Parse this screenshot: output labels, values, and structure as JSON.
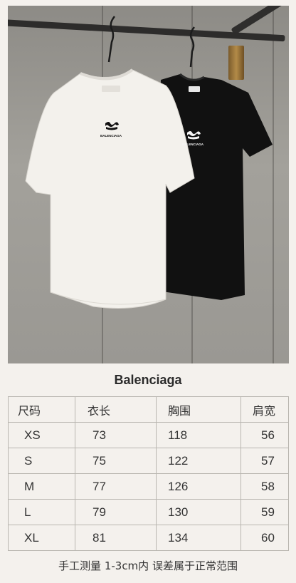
{
  "product": {
    "white_shirt_logo_text": "BALENCIAGA",
    "black_shirt_logo_text": "BALENCIAGA"
  },
  "title": "Balenciaga",
  "size_table": {
    "headers": [
      "尺码",
      "衣长",
      "胸围",
      "肩宽"
    ],
    "rows": [
      [
        "XS",
        "73",
        "118",
        "56"
      ],
      [
        "S",
        "75",
        "122",
        "57"
      ],
      [
        "M",
        "77",
        "126",
        "58"
      ],
      [
        "L",
        "79",
        "130",
        "59"
      ],
      [
        "XL",
        "81",
        "134",
        "60"
      ]
    ]
  },
  "footer_note": "手工测量 1-3cm内 误差属于正常范围",
  "colors": {
    "background": "#f4f1ed",
    "white_shirt": "#f3f1ec",
    "black_shirt": "#111111",
    "text": "#333333",
    "table_border": "#b9b6b0"
  }
}
